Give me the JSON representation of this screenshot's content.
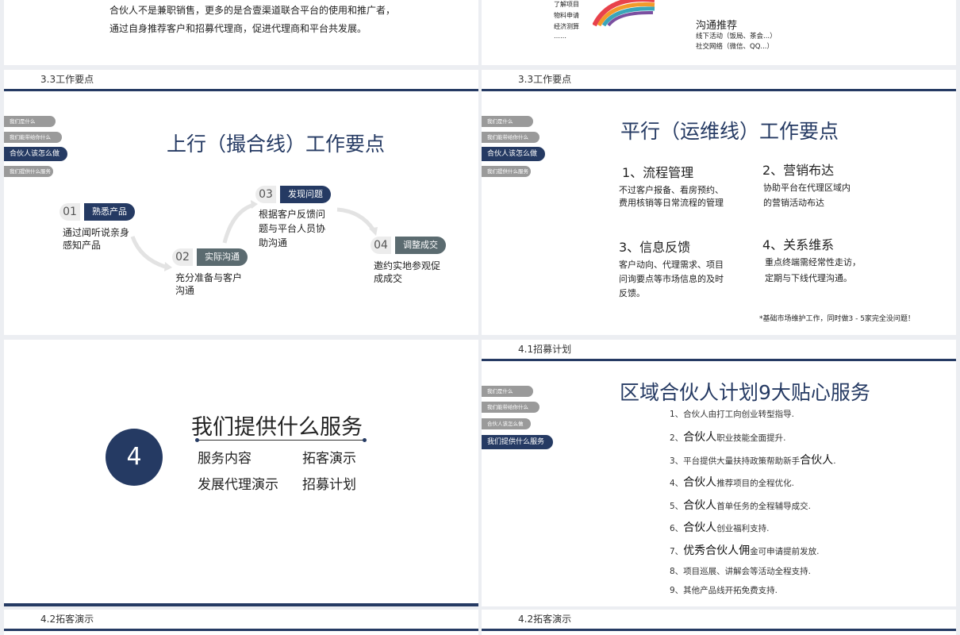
{
  "slide_tl": {
    "line1": "合伙人不是兼职销售，更多的是合壹渠道联合平台的使用和推广者，",
    "line2": "通过自身推荐客户和招募代理商，促进代理商和平台共发展。"
  },
  "slide_tr": {
    "left_lines": [
      "了解项目",
      "物料申请",
      "经济测算",
      "……"
    ],
    "heading": "沟通推荐",
    "line1": "线下活动（饭局、茶会...）",
    "line2": "社交网络（微信、QQ...）"
  },
  "nav": {
    "items": [
      "我们是什么",
      "我们能带给你什么",
      "合伙人该怎么做",
      "我们提供什么服务"
    ]
  },
  "slide_ml": {
    "section": "3.3工作要点",
    "title": "上行（撮合线）工作要点",
    "steps": [
      {
        "num": "01",
        "label": "熟悉产品",
        "desc1": "通过闻听说亲身",
        "desc2": "感知产品"
      },
      {
        "num": "02",
        "label": "实际沟通",
        "desc1": "充分准备与客户",
        "desc2": "沟通"
      },
      {
        "num": "03",
        "label": "发现问题",
        "desc1": "根据客户反馈问",
        "desc2": "题与平台人员协",
        "desc3": "助沟通"
      },
      {
        "num": "04",
        "label": "调整成交",
        "desc1": "邀约实地参观促",
        "desc2": "成成交"
      }
    ]
  },
  "slide_mr": {
    "section": "3.3工作要点",
    "title": "平行（运维线）工作要点",
    "items": [
      {
        "head": "1、流程管理",
        "l1": "不过客户报备、看房预约、",
        "l2": "费用核销等日常流程的管理"
      },
      {
        "head": "2、营销布达",
        "l1": "协助平台在代理区域内",
        "l2": "的营销活动布达"
      },
      {
        "head": "3、信息反馈",
        "l1": "客户动向、代理需求、项目",
        "l2": "问询要点等市场信息的及时",
        "l3": "反馈。"
      },
      {
        "head": "4、关系维系",
        "l1": "重点终端需经常性走访，",
        "l2": "定期与下线代理沟通。"
      }
    ],
    "note": "*基础市场维护工作，同时做3 - 5家完全没问题！"
  },
  "slide_bl": {
    "number": "4",
    "title": "我们提供什么服务",
    "items": [
      "服务内容",
      "拓客演示",
      "发展代理演示",
      "招募计划"
    ]
  },
  "slide_br": {
    "section": "4.1招募计划",
    "title": "区域合伙人计划9大贴心服务",
    "lines": [
      {
        "a": "1、合伙人由打工向创业转型指导.",
        "b": "",
        "c": ""
      },
      {
        "a": "2、",
        "b": "合伙人",
        "c": "职业技能全面提升."
      },
      {
        "a": "3、平台提供大量扶持政策帮助新手",
        "b": "合伙人",
        "c": "."
      },
      {
        "a": "4、",
        "b": "合伙人",
        "c": "推荐项目的全程优化."
      },
      {
        "a": "5、",
        "b": "合伙人",
        "c": "首单任务的全程辅导成交."
      },
      {
        "a": "6、",
        "b": "合伙人",
        "c": "创业福利支持."
      },
      {
        "a": "7、",
        "b": "优秀合伙人佣",
        "c": "金可申请提前发放."
      },
      {
        "a": "8、项目巡展、讲解会等活动全程支持.",
        "b": "",
        "c": ""
      },
      {
        "a": "9、其他产品线开拓免费支持.",
        "b": "",
        "c": ""
      }
    ]
  },
  "footer": {
    "left": "4.2拓客演示",
    "right": "4.2拓客演示"
  }
}
